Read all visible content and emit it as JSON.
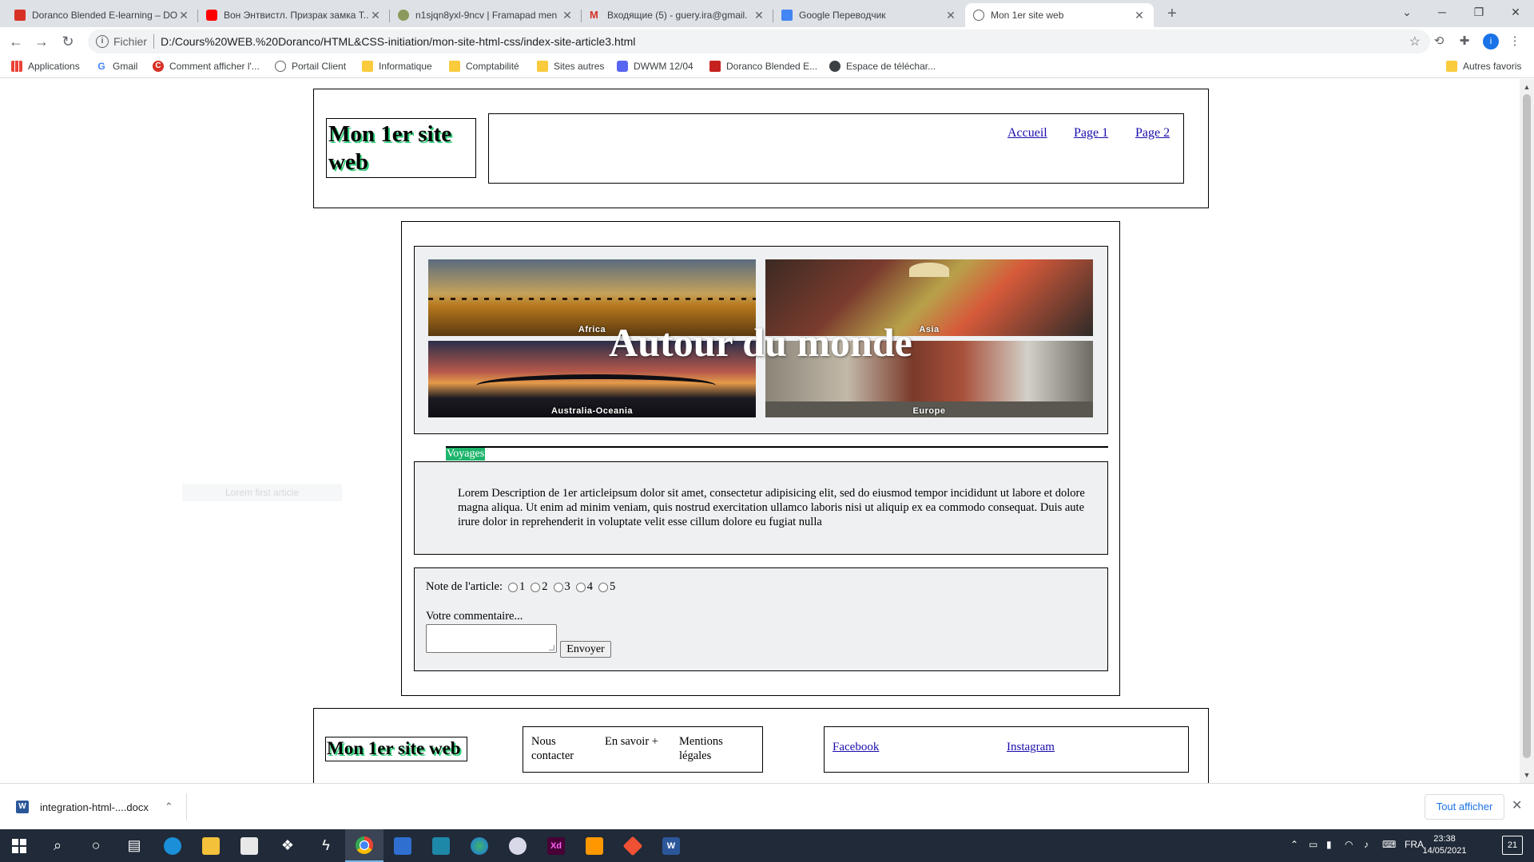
{
  "tabs": [
    {
      "title": "Doranco Blended E-learning – DO",
      "icon": "doranco-icon",
      "color": "#d93025",
      "active": false
    },
    {
      "title": "Вон Энтвистл. Призрак замка Т...",
      "icon": "youtube-icon",
      "color": "#ff0000",
      "active": false
    },
    {
      "title": "n1sjqn8yxl-9ncv | Framapad men",
      "icon": "framapad-icon",
      "color": "#8a9a5b",
      "active": false
    },
    {
      "title": "Входящие (5) - guery.ira@gmail.",
      "icon": "gmail-icon",
      "color": "#d93025",
      "active": false
    },
    {
      "title": "Google Переводчик",
      "icon": "google-translate-icon",
      "color": "#4285f4",
      "active": false
    },
    {
      "title": "Mon 1er site web",
      "icon": "globe-icon",
      "color": "#5f6368",
      "active": true
    }
  ],
  "address": {
    "scheme": "Fichier",
    "url": "D:/Cours%20WEB.%20Doranco/HTML&CSS-initiation/mon-site-html-css/index-site-article3.html"
  },
  "bookmarks": [
    {
      "label": "Applications",
      "icon": "apps-grid-icon"
    },
    {
      "label": "Gmail",
      "icon": "google-icon"
    },
    {
      "label": "Comment afficher l'...",
      "icon": "c-red-icon"
    },
    {
      "label": "Portail Client",
      "icon": "portal-icon"
    },
    {
      "label": "Informatique",
      "icon": "folder-icon"
    },
    {
      "label": "Comptabilité",
      "icon": "folder-icon"
    },
    {
      "label": "Sites autres",
      "icon": "folder-icon"
    },
    {
      "label": "DWWM 12/04",
      "icon": "discord-icon"
    },
    {
      "label": "Doranco Blended E...",
      "icon": "doranco-icon"
    },
    {
      "label": "Espace de téléchar...",
      "icon": "download-space-icon"
    }
  ],
  "bookmarks_other": "Autres favoris",
  "page": {
    "site_title": "Mon 1er site web",
    "nav": [
      "Accueil",
      "Page 1",
      "Page 2"
    ],
    "hero_title": "Autour du monde",
    "hero_tiles": [
      "Africa",
      "Asia",
      "Australia-Oceania",
      "Europe"
    ],
    "tag": "Voyages",
    "ghost_text": "Lorem first article",
    "article_text": "Lorem Description de 1er articleipsum dolor sit amet, consectetur adipisicing elit, sed do eiusmod tempor incididunt ut labore et dolore magna aliqua. Ut enim ad minim veniam, quis nostrud exercitation ullamco laboris nisi ut aliquip ex ea commodo consequat. Duis aute irure dolor in reprehenderit in voluptate velit esse cillum dolore eu fugiat nulla",
    "rating_label": "Note de l'article:",
    "rating_options": [
      "1",
      "2",
      "3",
      "4",
      "5"
    ],
    "comment_label": "Votre commentaire...",
    "comment_value": "",
    "send_label": "Envoyer",
    "footer": {
      "title": "Mon 1er site web",
      "links": [
        "Nous contacter",
        "En savoir +",
        "Mentions légales"
      ],
      "social": [
        "Facebook",
        "Instagram"
      ]
    }
  },
  "downloads": {
    "file": "integration-html-....docx",
    "show_all": "Tout afficher"
  },
  "taskbar": {
    "apps": [
      "windows-start",
      "search",
      "cortana",
      "task-view",
      "edge",
      "file-explorer",
      "store",
      "dropbox",
      "bolt",
      "chrome",
      "remote-desktop",
      "terminal",
      "earth",
      "cloud",
      "xd",
      "sublime",
      "git",
      "word"
    ],
    "language": "FRA",
    "time": "23:38",
    "date": "14/05/2021",
    "notifications": "21"
  },
  "colors": {
    "title_shadow": "#2fd07a",
    "tag_bg": "#1db56b",
    "panel_bg": "#eef0f1",
    "link": "#1a0dab"
  }
}
